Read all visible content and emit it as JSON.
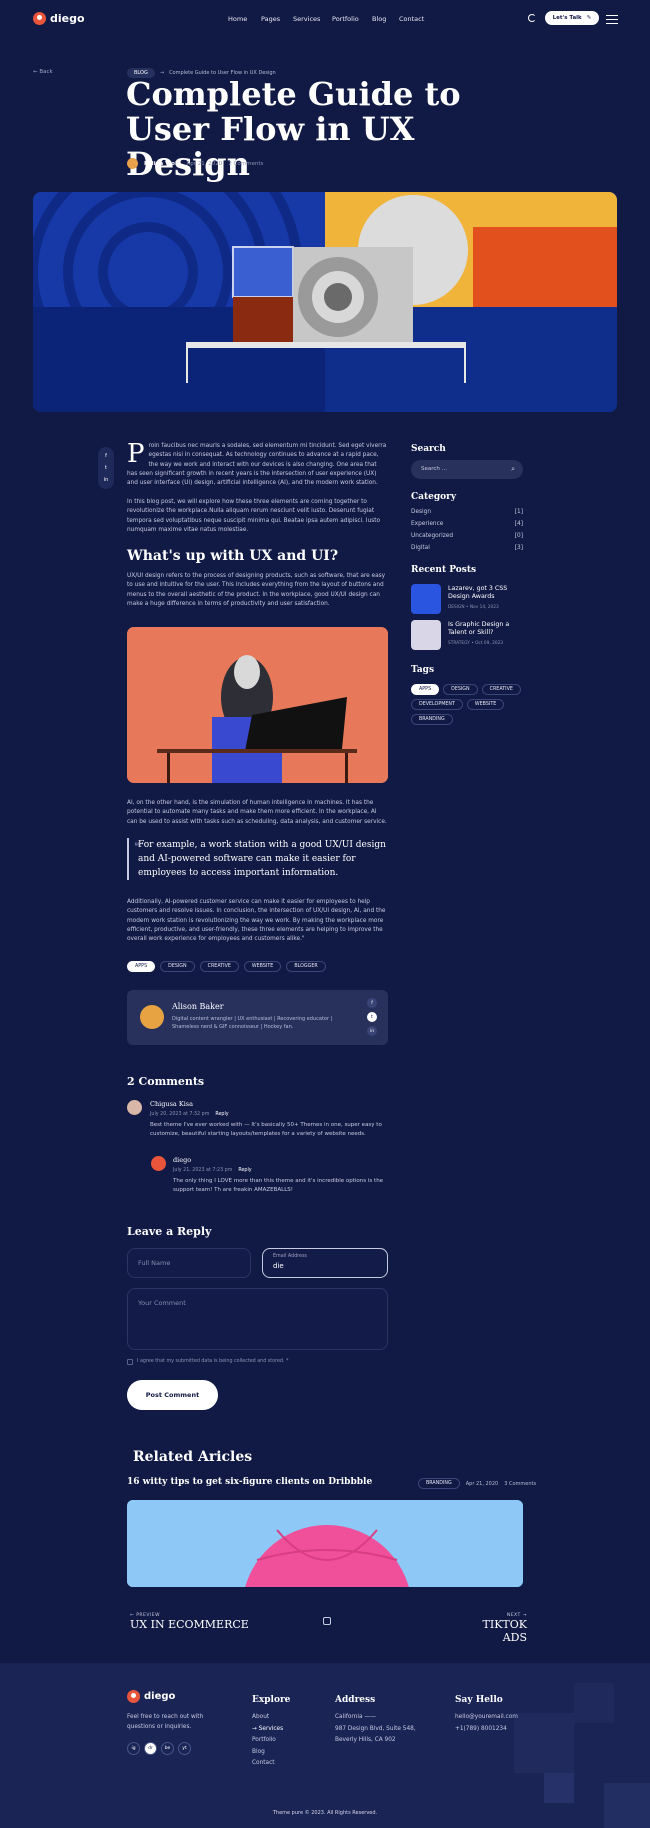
{
  "header": {
    "logo": "diego",
    "nav": [
      "Home",
      "Pages",
      "Services",
      "Portfolio",
      "Blog",
      "Contact"
    ],
    "cta": "Let's Talk"
  },
  "hero": {
    "back": "Back",
    "crumb_pill": "BLOG",
    "crumb_text": "Complete Guide to User Flow in UX Design",
    "title": "Complete Guide to User Flow in UX Design",
    "author": "Polina Viola",
    "date": "Apr 21, 2020",
    "comments": "2 Comments"
  },
  "share": [
    "f",
    "t",
    "in"
  ],
  "article": {
    "drop_cap": "P",
    "p1": "roin faucibus nec mauris a sodales, sed elementum mi tincidunt. Sed eget viverra egestas nisi in consequat. As technology continues to advance at a rapid pace, the way we work and interact with our devices is also changing. One area that has seen significant growth in recent years is the intersection of user experience (UX) and user interface (UI) design, artificial intelligence (AI), and the modern work station.",
    "p2": "In this blog post, we will explore how these three elements are coming together to revolutionize the workplace.Nulla aliquam rerum nesciunt velit iusto. Deserunt fugiat tempora sed voluptatibus neque suscipit minima qui. Beatae ipsa autem adipisci. Iusto numquam maxime vitae natus molestiae.",
    "h2": "What's up with UX and UI?",
    "p3": "UX/UI design refers to the process of designing products, such as software, that are easy to use and intuitive for the user. This includes everything from the layout of buttons and menus to the overall aesthetic of the product. In the workplace, good UX/UI design can make a huge difference in terms of productivity and user satisfaction.",
    "p4": "AI, on the other hand, is the simulation of human intelligence in machines. It has the potential to automate many tasks and make them more efficient. In the workplace, AI can be used to assist with tasks such as scheduling, data analysis, and customer service.",
    "quote": "For example, a work station with a good UX/UI design and AI-powered software can make it easier for employees to access important information.",
    "p5": "Additionally, AI-powered customer service can make it easier for employees to help customers and resolve issues. In conclusion, the intersection of UX/UI design, AI, and the modern work station is revolutionizing the way we work. By making the workplace more efficient, productive, and user-friendly, these three elements are helping to improve the overall work experience for employees and customers alike.\"",
    "tags": [
      "APPS",
      "DESIGN",
      "CREATIVE",
      "WEBSITE",
      "BLOGGER"
    ]
  },
  "author_box": {
    "name": "Alison Baker",
    "bio": "Digital content wrangler | UX enthusiast | Recovering educator | Shameless nerd & GIF connoisseur | Hockey fan.",
    "social": [
      "f",
      "t",
      "in"
    ]
  },
  "comments": {
    "heading": "2 Comments",
    "items": [
      {
        "name": "Chigusa Kisa",
        "date": "July 20, 2023 at 7:32 pm",
        "reply": "Reply",
        "text": "Best theme I've ever worked with — It's basically 50+ Themes in one, super easy to customize, beautiful starting layouts/templates for a variety of website needs."
      },
      {
        "name": "diego",
        "date": "July 21, 2023 at 7:23 pm",
        "reply": "Reply",
        "text": "The only thing I LOVE more than this theme and it's incredible options is the support team! Th are freakin AMAZEBALLS!"
      }
    ]
  },
  "reply_form": {
    "heading": "Leave a Reply",
    "name_placeholder": "Full Name",
    "email_label": "Email Address",
    "email_value": "die",
    "comment_placeholder": "Your Comment",
    "consent": "I agree that my submitted data is being collected and stored. *",
    "submit": "Post Comment"
  },
  "sidebar": {
    "search_heading": "Search",
    "search_placeholder": "Search ...",
    "category_heading": "Category",
    "categories": [
      {
        "name": "Design",
        "count": "[1]"
      },
      {
        "name": "Experience",
        "count": "[4]"
      },
      {
        "name": "Uncategorized",
        "count": "[0]"
      },
      {
        "name": "Digital",
        "count": "[3]"
      }
    ],
    "recent_heading": "Recent Posts",
    "recent": [
      {
        "title": "Lazarev, got 3 CSS Design Awards",
        "meta": "DESIGN • Nov 14, 2023"
      },
      {
        "title": "Is Graphic Design a Talent or Skill?",
        "meta": "STRATEGY • Oct 09, 2023"
      }
    ],
    "tags_heading": "Tags",
    "tags": [
      "APPS",
      "DESIGN",
      "CREATIVE",
      "DEVELOPMENT",
      "WEBSITE",
      "BRANDING"
    ]
  },
  "related": {
    "heading": "Related Aricles",
    "post_title": "16 witty tips to get six-figure clients on Dribbble",
    "tag": "BRANDING",
    "date": "Apr 21, 2020",
    "comments": "3 Comments"
  },
  "pager": {
    "prev_label": "PREVIEW",
    "prev_title": "UX IN ECOMMERCE",
    "next_label": "NEXT",
    "next_title": "TIKTOK ADS"
  },
  "footer": {
    "logo": "diego",
    "blurb": "Feel free to reach out with questions or inquiries.",
    "social": [
      "ig",
      "dr",
      "be",
      "yt"
    ],
    "explore_heading": "Explore",
    "explore": [
      "About",
      "Services",
      "Portfolio",
      "Blog",
      "Contact"
    ],
    "address_heading": "Address",
    "address": [
      "California ——",
      "987 Design Blvd, Suite 548,",
      "Beverly Hills, CA 902"
    ],
    "hello_heading": "Say Hello",
    "hello": [
      "hello@youremail.com",
      "+1(789) 8001234"
    ],
    "copyright": "Theme pure © 2023. All Rights Reserved."
  }
}
